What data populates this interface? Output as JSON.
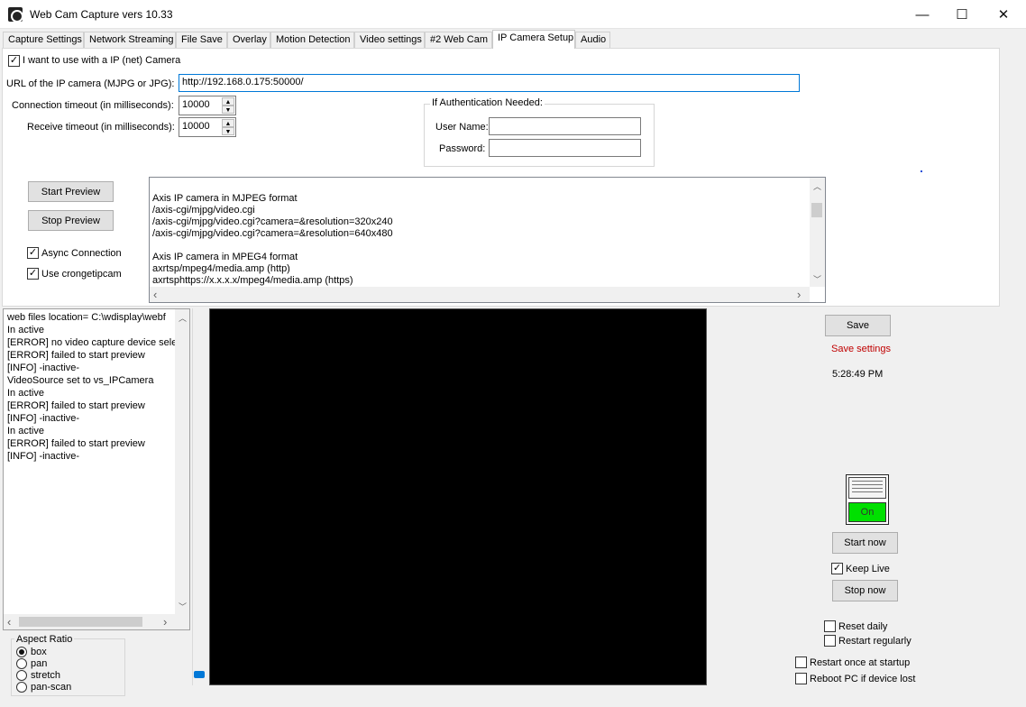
{
  "window": {
    "title": "Web Cam Capture vers 10.33",
    "minimize": "—",
    "maximize": "☐",
    "close": "✕"
  },
  "tabs": [
    {
      "label": "Capture Settings"
    },
    {
      "label": "Network Streaming"
    },
    {
      "label": "File Save"
    },
    {
      "label": "Overlay"
    },
    {
      "label": "Motion Detection"
    },
    {
      "label": "Video settings"
    },
    {
      "label": "#2 Web Cam"
    },
    {
      "label": "IP Camera Setup"
    },
    {
      "label": "Audio"
    }
  ],
  "ipcam": {
    "use_ip_label": "I want to use with a IP (net) Camera",
    "use_ip_checked": true,
    "url_label": "URL of the IP camera (MJPG or JPG):",
    "url_value": "http://192.168.0.175:50000/",
    "conn_timeout_label": "Connection timeout  (in milliseconds):",
    "conn_timeout_value": "10000",
    "recv_timeout_label": "Receive timeout (in milliseconds):",
    "recv_timeout_value": "10000",
    "auth_title": "If Authentication Needed:",
    "username_label": "User Name:",
    "username_value": "",
    "password_label": "Password:",
    "password_value": "",
    "start_preview": "Start Preview",
    "stop_preview": "Stop Preview",
    "async_label": "Async Connection",
    "async_checked": true,
    "crongetipcam_label": "Use crongetipcam",
    "crongetipcam_checked": true,
    "help_lines": [
      "",
      "Axis IP camera in MJPEG format",
      "/axis-cgi/mjpg/video.cgi",
      "/axis-cgi/mjpg/video.cgi?camera=&resolution=320x240",
      "/axis-cgi/mjpg/video.cgi?camera=&resolution=640x480",
      "",
      "Axis IP camera in MPEG4 format",
      "axrtsp/mpeg4/media.amp (http)",
      "axrtsphttps://x.x.x.x/mpeg4/media.amp (https)"
    ]
  },
  "log": {
    "lines": [
      "web files location= C:\\wdisplay\\webf",
      "In active",
      "[ERROR] no video capture device sele",
      "[ERROR] failed to start preview",
      "[INFO] -inactive-",
      "VideoSource set to vs_IPCamera",
      "In active",
      "[ERROR] failed to start preview",
      "[INFO] -inactive-",
      "In active",
      "[ERROR] failed to start preview",
      "[INFO] -inactive-"
    ]
  },
  "aspect": {
    "title": "Aspect Ratio",
    "options": [
      {
        "label": "box",
        "selected": true
      },
      {
        "label": "pan",
        "selected": false
      },
      {
        "label": "stretch",
        "selected": false
      },
      {
        "label": "pan-scan",
        "selected": false
      }
    ]
  },
  "right": {
    "save": "Save",
    "save_status": "Save settings",
    "save_status_color": "#c00000",
    "time": "5:28:49 PM",
    "switch_label": "On",
    "switch_color": "#00e000",
    "start_now": "Start now",
    "keep_live_label": "Keep Live",
    "keep_live_checked": true,
    "stop_now": "Stop now",
    "reset_daily": "Reset daily",
    "restart_regularly": "Restart regularly",
    "restart_startup": "Restart once at startup",
    "reboot_pc": "Reboot PC if device lost"
  },
  "icons": {
    "check": "✓",
    "up": "▲",
    "down": "▼",
    "left": "‹",
    "right": "›",
    "up_caret": "︿",
    "down_caret": "﹀"
  }
}
